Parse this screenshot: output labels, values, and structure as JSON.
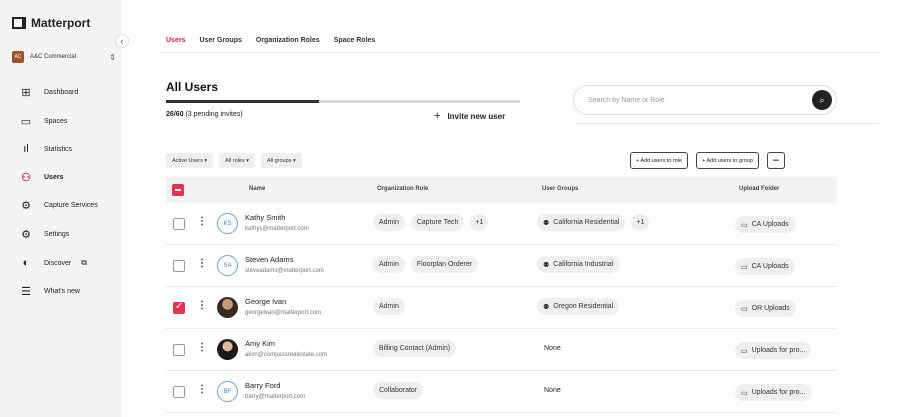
{
  "brand": {
    "name": "Matterport"
  },
  "org": {
    "initials": "AC",
    "name": "A&C Commercial",
    "toggle": "⇕"
  },
  "sidebar": {
    "collapse": "‹",
    "items": [
      {
        "label": "Dashboard",
        "icon": "⊞"
      },
      {
        "label": "Spaces",
        "icon": "▭"
      },
      {
        "label": "Statistics",
        "icon": "ıl"
      },
      {
        "label": "Users",
        "icon": "⚇"
      },
      {
        "label": "Capture Services",
        "icon": "⚙"
      },
      {
        "label": "Settings",
        "icon": "⚙"
      },
      {
        "label": "Discover",
        "icon": "◐",
        "external": "⧉"
      },
      {
        "label": "What's new",
        "icon": "☰"
      }
    ]
  },
  "tabs": [
    "Users",
    "User Groups",
    "Organization Roles",
    "Space Roles"
  ],
  "page": {
    "title": "All Users",
    "seats_bold": "26/60",
    "seats_rest": " (3 pending invites)",
    "seats_progress": 0.433,
    "invite_plus": "+",
    "invite_label": "Invite new user"
  },
  "search": {
    "placeholder": "Search by Name or Role",
    "icon": "⌕"
  },
  "filters": [
    "Active Users ▾",
    "All roles ▾",
    "All groups ▾"
  ],
  "actions": [
    "+ Add users to role",
    "+ Add users to group",
    "•••"
  ],
  "table": {
    "columns": [
      "Name",
      "Organization Role",
      "User Groups",
      "Upload Folder"
    ],
    "rows": [
      {
        "initials": "KS",
        "name": "Kathy Smith",
        "email": "kathys@matterport.com",
        "roles": [
          "Admin",
          "Capture Tech",
          "+1"
        ],
        "groups": [
          "California Residential",
          "+1"
        ],
        "folder": "CA Uploads",
        "checked": false
      },
      {
        "initials": "SA",
        "name": "Steven Adams",
        "email": "steveadams@matterport.com",
        "roles": [
          "Admin",
          "Floorplan Orderer"
        ],
        "groups": [
          "California Industrial"
        ],
        "folder": "CA Uploads",
        "checked": false
      },
      {
        "initials": "",
        "name": "George Ivan",
        "email": "georgeivan@matterport.com",
        "roles": [
          "Admin"
        ],
        "groups": [
          "Oregon Residential"
        ],
        "folder": "OR Uploads",
        "checked": true
      },
      {
        "initials": "",
        "name": "Amy Kim",
        "email": "akim@compassrealestate.com",
        "roles": [
          "Billing Contact (Admin)"
        ],
        "groups": [],
        "groups_none": "None",
        "folder": "Uploads for pro...",
        "checked": false
      },
      {
        "initials": "BF",
        "name": "Barry Ford",
        "email": "barry@matterport.com",
        "roles": [
          "Collaborator"
        ],
        "groups": [],
        "groups_none": "None",
        "folder": "Uploads for pro...",
        "checked": false
      }
    ]
  },
  "colors": {
    "accent": "#e23352",
    "sidebar_bg": "#f4f4f5"
  }
}
